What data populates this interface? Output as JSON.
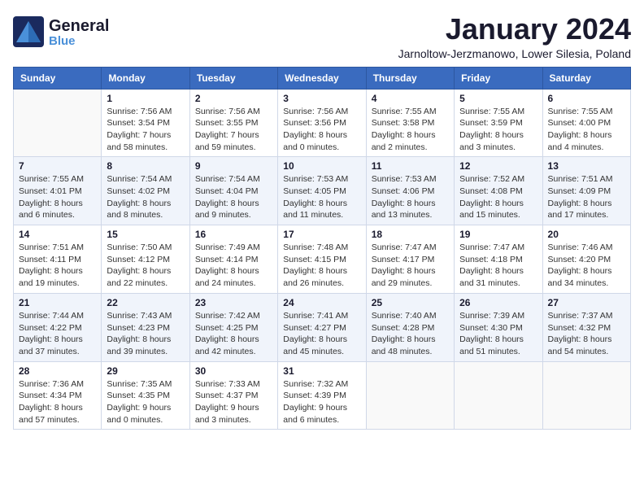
{
  "header": {
    "logo_general": "General",
    "logo_blue": "Blue",
    "month_title": "January 2024",
    "location": "Jarnoltow-Jerzmanowo, Lower Silesia, Poland"
  },
  "weekdays": [
    "Sunday",
    "Monday",
    "Tuesday",
    "Wednesday",
    "Thursday",
    "Friday",
    "Saturday"
  ],
  "weeks": [
    [
      {
        "day": "",
        "info": ""
      },
      {
        "day": "1",
        "info": "Sunrise: 7:56 AM\nSunset: 3:54 PM\nDaylight: 7 hours\nand 58 minutes."
      },
      {
        "day": "2",
        "info": "Sunrise: 7:56 AM\nSunset: 3:55 PM\nDaylight: 7 hours\nand 59 minutes."
      },
      {
        "day": "3",
        "info": "Sunrise: 7:56 AM\nSunset: 3:56 PM\nDaylight: 8 hours\nand 0 minutes."
      },
      {
        "day": "4",
        "info": "Sunrise: 7:55 AM\nSunset: 3:58 PM\nDaylight: 8 hours\nand 2 minutes."
      },
      {
        "day": "5",
        "info": "Sunrise: 7:55 AM\nSunset: 3:59 PM\nDaylight: 8 hours\nand 3 minutes."
      },
      {
        "day": "6",
        "info": "Sunrise: 7:55 AM\nSunset: 4:00 PM\nDaylight: 8 hours\nand 4 minutes."
      }
    ],
    [
      {
        "day": "7",
        "info": "Sunrise: 7:55 AM\nSunset: 4:01 PM\nDaylight: 8 hours\nand 6 minutes."
      },
      {
        "day": "8",
        "info": "Sunrise: 7:54 AM\nSunset: 4:02 PM\nDaylight: 8 hours\nand 8 minutes."
      },
      {
        "day": "9",
        "info": "Sunrise: 7:54 AM\nSunset: 4:04 PM\nDaylight: 8 hours\nand 9 minutes."
      },
      {
        "day": "10",
        "info": "Sunrise: 7:53 AM\nSunset: 4:05 PM\nDaylight: 8 hours\nand 11 minutes."
      },
      {
        "day": "11",
        "info": "Sunrise: 7:53 AM\nSunset: 4:06 PM\nDaylight: 8 hours\nand 13 minutes."
      },
      {
        "day": "12",
        "info": "Sunrise: 7:52 AM\nSunset: 4:08 PM\nDaylight: 8 hours\nand 15 minutes."
      },
      {
        "day": "13",
        "info": "Sunrise: 7:51 AM\nSunset: 4:09 PM\nDaylight: 8 hours\nand 17 minutes."
      }
    ],
    [
      {
        "day": "14",
        "info": "Sunrise: 7:51 AM\nSunset: 4:11 PM\nDaylight: 8 hours\nand 19 minutes."
      },
      {
        "day": "15",
        "info": "Sunrise: 7:50 AM\nSunset: 4:12 PM\nDaylight: 8 hours\nand 22 minutes."
      },
      {
        "day": "16",
        "info": "Sunrise: 7:49 AM\nSunset: 4:14 PM\nDaylight: 8 hours\nand 24 minutes."
      },
      {
        "day": "17",
        "info": "Sunrise: 7:48 AM\nSunset: 4:15 PM\nDaylight: 8 hours\nand 26 minutes."
      },
      {
        "day": "18",
        "info": "Sunrise: 7:47 AM\nSunset: 4:17 PM\nDaylight: 8 hours\nand 29 minutes."
      },
      {
        "day": "19",
        "info": "Sunrise: 7:47 AM\nSunset: 4:18 PM\nDaylight: 8 hours\nand 31 minutes."
      },
      {
        "day": "20",
        "info": "Sunrise: 7:46 AM\nSunset: 4:20 PM\nDaylight: 8 hours\nand 34 minutes."
      }
    ],
    [
      {
        "day": "21",
        "info": "Sunrise: 7:44 AM\nSunset: 4:22 PM\nDaylight: 8 hours\nand 37 minutes."
      },
      {
        "day": "22",
        "info": "Sunrise: 7:43 AM\nSunset: 4:23 PM\nDaylight: 8 hours\nand 39 minutes."
      },
      {
        "day": "23",
        "info": "Sunrise: 7:42 AM\nSunset: 4:25 PM\nDaylight: 8 hours\nand 42 minutes."
      },
      {
        "day": "24",
        "info": "Sunrise: 7:41 AM\nSunset: 4:27 PM\nDaylight: 8 hours\nand 45 minutes."
      },
      {
        "day": "25",
        "info": "Sunrise: 7:40 AM\nSunset: 4:28 PM\nDaylight: 8 hours\nand 48 minutes."
      },
      {
        "day": "26",
        "info": "Sunrise: 7:39 AM\nSunset: 4:30 PM\nDaylight: 8 hours\nand 51 minutes."
      },
      {
        "day": "27",
        "info": "Sunrise: 7:37 AM\nSunset: 4:32 PM\nDaylight: 8 hours\nand 54 minutes."
      }
    ],
    [
      {
        "day": "28",
        "info": "Sunrise: 7:36 AM\nSunset: 4:34 PM\nDaylight: 8 hours\nand 57 minutes."
      },
      {
        "day": "29",
        "info": "Sunrise: 7:35 AM\nSunset: 4:35 PM\nDaylight: 9 hours\nand 0 minutes."
      },
      {
        "day": "30",
        "info": "Sunrise: 7:33 AM\nSunset: 4:37 PM\nDaylight: 9 hours\nand 3 minutes."
      },
      {
        "day": "31",
        "info": "Sunrise: 7:32 AM\nSunset: 4:39 PM\nDaylight: 9 hours\nand 6 minutes."
      },
      {
        "day": "",
        "info": ""
      },
      {
        "day": "",
        "info": ""
      },
      {
        "day": "",
        "info": ""
      }
    ]
  ]
}
